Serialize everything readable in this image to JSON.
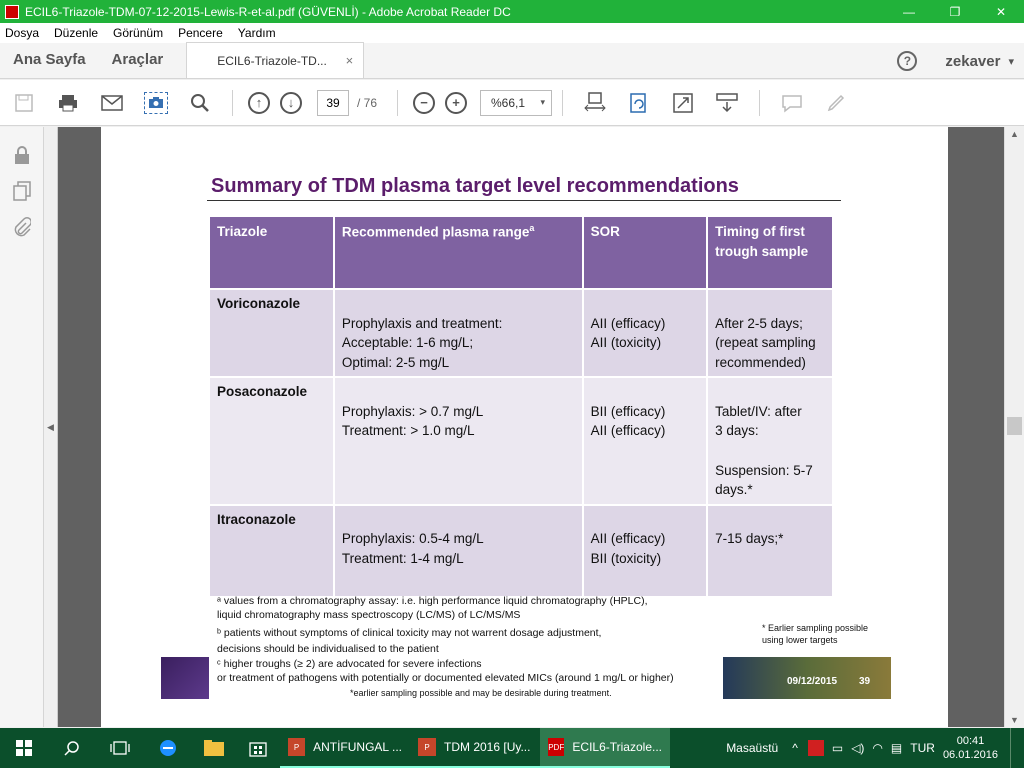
{
  "window": {
    "title": "ECIL6-Triazole-TDM-07-12-2015-Lewis-R-et-al.pdf (GÜVENLİ) - Adobe Acrobat Reader DC",
    "minimize": "—",
    "maximize": "❐",
    "close": "✕"
  },
  "menu": [
    "Dosya",
    "Düzenle",
    "Görünüm",
    "Pencere",
    "Yardım"
  ],
  "tabs": {
    "home": "Ana Sayfa",
    "tools": "Araçlar",
    "document": "ECIL6-Triazole-TD...",
    "close": "×",
    "help": "?",
    "user": "zekaver",
    "user_caret": "▾"
  },
  "toolbar": {
    "current_page": "39",
    "total_pages": "/ 76",
    "zoom": "%66,1",
    "zoom_caret": "▾"
  },
  "slide": {
    "title": "Summary of TDM plasma target level recommendations",
    "headers": [
      "Triazole",
      "Recommended plasma range",
      "SOR",
      "Timing of first trough sample"
    ],
    "header_sup": "a",
    "rows": [
      {
        "drug": "Voriconazole",
        "range": "\nProphylaxis and treatment:\nAcceptable: 1-6 mg/L;\nOptimal: 2-5 mg/L",
        "sor": "\nAII (efficacy)\nAII (toxicity)",
        "timing": "\nAfter 2-5 days;\n(repeat sampling recommended)"
      },
      {
        "drug": "Posaconazole",
        "range": "\nProphylaxis: > 0.7 mg/L\nTreatment: > 1.0 mg/L",
        "sor": "\nBII (efficacy)\nAII (efficacy)",
        "timing": "\nTablet/IV: after\n 3 days:\n\nSuspension: 5-7 days.*"
      },
      {
        "drug": "Itraconazole",
        "range": "\nProphylaxis: 0.5-4 mg/L\nTreatment: 1-4 mg/L",
        "sor": "\nAII (efficacy)\nBII (toxicity)",
        "timing": "\n7-15 days;*"
      }
    ],
    "footnotes": {
      "a1": "ᵃ values from a chromatography assay: i.e. high performance liquid chromatography (HPLC),",
      "a2": "liquid chromatography mass spectroscopy (LC/MS) of LC/MS/MS",
      "b1": "ᵇ patients without symptoms of clinical toxicity may not warrent dosage adjustment,",
      "b2": "decisions should be individualised to the patient",
      "c1": "ᶜ higher troughs (≥ 2) are advocated for severe infections",
      "c2": "or treatment of pathogens with potentially or documented elevated MICs (around 1 mg/L or higher)",
      "star": "*earlier sampling possible and may be desirable during treatment."
    },
    "right_note": "* Earlier sampling possible\nusing lower targets",
    "footer_date": "09/12/2015",
    "footer_page": "39"
  },
  "taskbar": {
    "apps": [
      {
        "label": "ANTİFUNGAL ..."
      },
      {
        "label": "TDM 2016 [Uy..."
      },
      {
        "label": "ECIL6-Triazole..."
      }
    ],
    "desktop": "Masaüstü",
    "language": "TUR",
    "time": "00:41",
    "date": "06.01.2016"
  }
}
